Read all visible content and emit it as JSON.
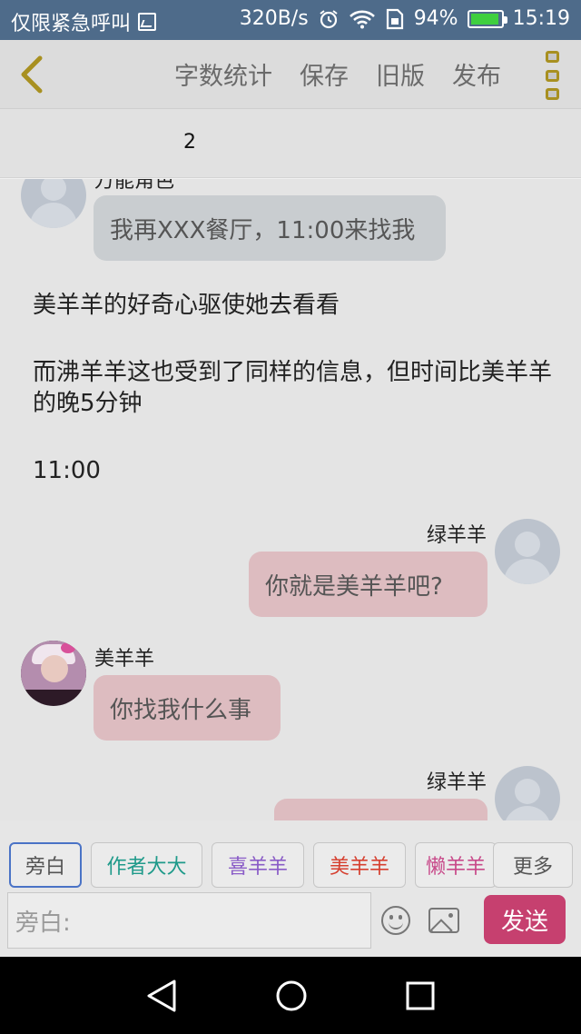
{
  "status_bar": {
    "carrier_text": "仅限紧急呼叫",
    "speed": "320B/s",
    "battery_percent": "94%",
    "battery_level": 0.94,
    "time": "15:19"
  },
  "top_bar": {
    "menu": [
      "字数统计",
      "保存",
      "旧版",
      "发布"
    ]
  },
  "word_count": "2",
  "chat": {
    "partial_name": "万能角色",
    "msg1": "我再XXX餐厅，11:00来找我",
    "narration1": "美羊羊的好奇心驱使她去看看",
    "narration2": "而沸羊羊这也受到了同样的信息，但时间比美羊羊的晚5分钟",
    "narration3": "11:00",
    "speaker2": "绿羊羊",
    "msg2": "你就是美羊羊吧?",
    "speaker3": "美羊羊",
    "msg3": "你找我什么事",
    "speaker4": "绿羊羊"
  },
  "characters": [
    {
      "label": "旁白",
      "color": "#555555"
    },
    {
      "label": "作者大大",
      "color": "#1f9a8a"
    },
    {
      "label": "喜羊羊",
      "color": "#8a5cc7"
    },
    {
      "label": "美羊羊",
      "color": "#d64030"
    },
    {
      "label": "懒羊羊",
      "color": "#c84a8a"
    },
    {
      "label": "更多",
      "color": "#555555"
    }
  ],
  "input": {
    "placeholder": "旁白:",
    "send_label": "发送"
  },
  "colors": {
    "accent": "#c6406f",
    "status_bar": "#4e6b8a",
    "active_chip_border": "#4a73c6"
  }
}
